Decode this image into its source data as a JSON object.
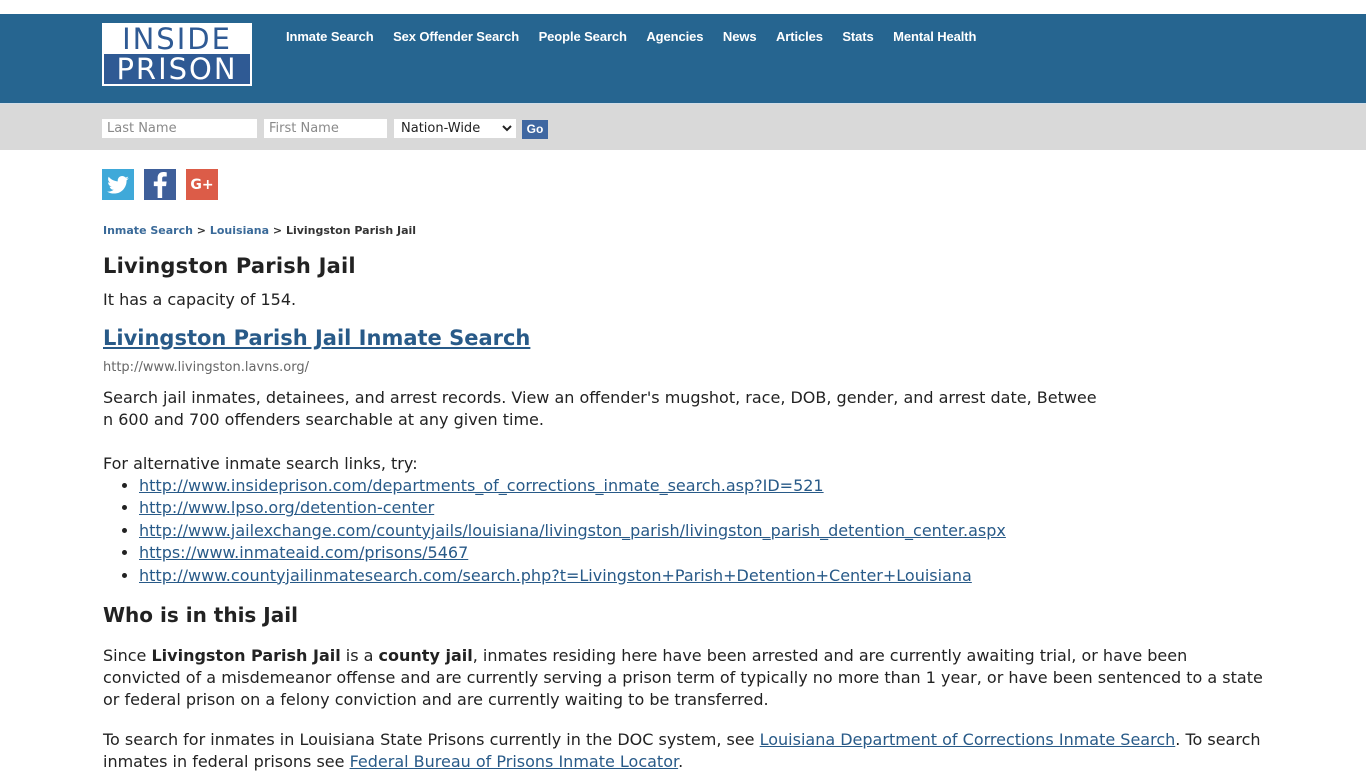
{
  "header": {
    "logo": {
      "top": "INSIDE",
      "bottom": "PRISON"
    },
    "nav": [
      {
        "label": "Inmate Search"
      },
      {
        "label": "Sex Offender Search"
      },
      {
        "label": "People Search"
      },
      {
        "label": "Agencies"
      },
      {
        "label": "News"
      },
      {
        "label": "Articles"
      },
      {
        "label": "Stats"
      },
      {
        "label": "Mental Health"
      }
    ]
  },
  "search": {
    "last_name_placeholder": "Last Name",
    "first_name_placeholder": "First Name",
    "scope_selected": "Nation-Wide",
    "go_label": "Go"
  },
  "social": {
    "twitter": "twitter-icon",
    "facebook": "facebook-icon",
    "googleplus": "google-plus-icon",
    "googleplus_glyph": "G+"
  },
  "breadcrumb": {
    "items": [
      "Inmate Search",
      "Louisiana"
    ],
    "separator": ">",
    "current": "Livingston Parish Jail"
  },
  "page": {
    "title": "Livingston Parish Jail",
    "capacity_text": "It has a capacity of 154.",
    "search_link": "Livingston Parish Jail Inmate Search",
    "search_url": "http://www.livingston.lavns.org/",
    "description_line1": "Search jail inmates, detainees, and arrest records. View an offender's mugshot, race, DOB, gender, and arrest date, Betwee",
    "description_line2": "n 600 and 700 offenders searchable at any given time.",
    "alt_intro": "For alternative inmate search links, try:",
    "alt_links": [
      "http://www.insideprison.com/departments_of_corrections_inmate_search.asp?ID=521",
      "http://www.lpso.org/detention-center",
      "http://www.jailexchange.com/countyjails/louisiana/livingston_parish/livingston_parish_detention_center.aspx",
      "https://www.inmateaid.com/prisons/5467",
      "http://www.countyjailinmatesearch.com/search.php?t=Livingston+Parish+Detention+Center+Louisiana"
    ],
    "who_heading": "Who is in this Jail",
    "who": {
      "since": "Since ",
      "jail_name": "Livingston Parish Jail",
      "is_a": " is a ",
      "jail_type": "county jail",
      "rest": ", inmates residing here have been arrested and are currently awaiting trial, or have been convicted of a misdemeanor offense and are currently serving a prison term of typically no more than 1 year, or have been sentenced to a state or federal prison on a felony conviction and are currently waiting to be transferred."
    },
    "doc": {
      "text1": "To search for inmates in Louisiana State Prisons currently in the DOC system, see ",
      "link1": "Louisiana Department of Corrections Inmate Search",
      "text2": ". To search inmates in federal prisons see ",
      "link2": "Federal Bureau of Prisons Inmate Locator",
      "text3": "."
    }
  }
}
